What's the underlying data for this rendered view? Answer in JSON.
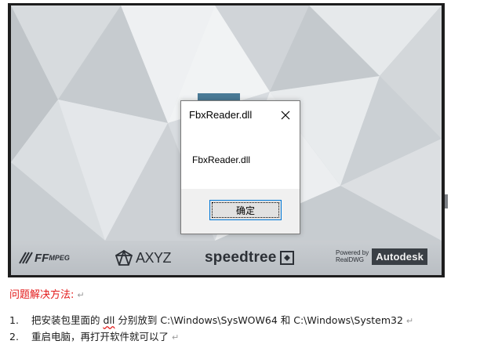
{
  "splash": {
    "logos": {
      "ffmpeg": "FF",
      "ffmpeg_small": "MPEG",
      "axyz": "AXYZ",
      "speedtree": "speedtree",
      "powered_line1": "Powered by",
      "powered_line2": "RealDWG",
      "autodesk": "Autodesk"
    }
  },
  "dialog": {
    "title": "FbxReader.dll",
    "close_icon": "close-icon",
    "message": "FbxReader.dll",
    "ok_label": "确定"
  },
  "document": {
    "heading": "问题解决方法:",
    "steps": [
      {
        "num": "1.",
        "text_before": "把安装包里面的 ",
        "dll_word": "dll",
        "text_after": " 分别放到 C:\\Windows\\SysWOW64 和 C:\\Windows\\System32"
      },
      {
        "num": "2.",
        "text": "重启电脑，再打开软件就可以了"
      }
    ],
    "paragraph_mark": "↵"
  },
  "colors": {
    "heading": "#e31c1c",
    "dialog_button_border": "#0078d7"
  }
}
